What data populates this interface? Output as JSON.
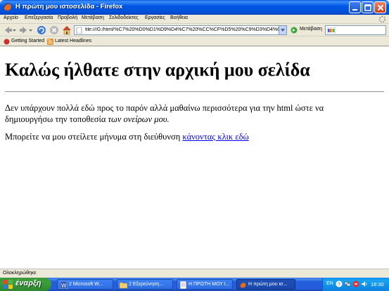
{
  "window": {
    "title": "Η πρώτη μου ιστοσελίδα - Firefox"
  },
  "menubar": {
    "items": [
      "Αρχείο",
      "Επεξεργασία",
      "Προβολή",
      "Μετάβαση",
      "Σελιδοδείκτες",
      "Εργασίες",
      "Βοήθεια"
    ]
  },
  "navbar": {
    "url": "file:///G:/html/%C7%20%D0%D1%D9%D4%C7%20%CC%CF%D5%20%C9%D3%D4%C",
    "go_label": "Μετάβαση",
    "search_value": ""
  },
  "bookmarks": {
    "items": [
      "Getting Started",
      "Latest Headlines"
    ]
  },
  "content": {
    "heading": "Καλώς ήλθατε στην αρχική μου σελίδα",
    "para1_plain": "Δεν υπάρχουν πολλά εδώ προς το παρόν αλλά μαθαίνω περισσότερα για την html ώστε να δημιουργήσω την τοποθεσία ",
    "para1_italic": "των ονείρων μου.",
    "para2_text": "Μπορείτε να μου στείλετε μήνυμα στη διεύθυνση ",
    "para2_link": "κάνοντας κλικ εδώ"
  },
  "statusbar": {
    "text": "Ολοκληρώθηκε"
  },
  "taskbar": {
    "start_label": "έναρξη",
    "tasks": [
      "2 Microsoft W...",
      "2 Εξερεύνηση...",
      "Η ΠΡΩΤΗ ΜΟΥ Ι...",
      "Η πρώτη μου ισ..."
    ],
    "language": "EN",
    "clock": "18:30"
  },
  "colors": {
    "titlebar": "#0058E6",
    "link": "#0000EE",
    "taskbar": "#245EDB",
    "start_button": "#3B9E3B"
  }
}
